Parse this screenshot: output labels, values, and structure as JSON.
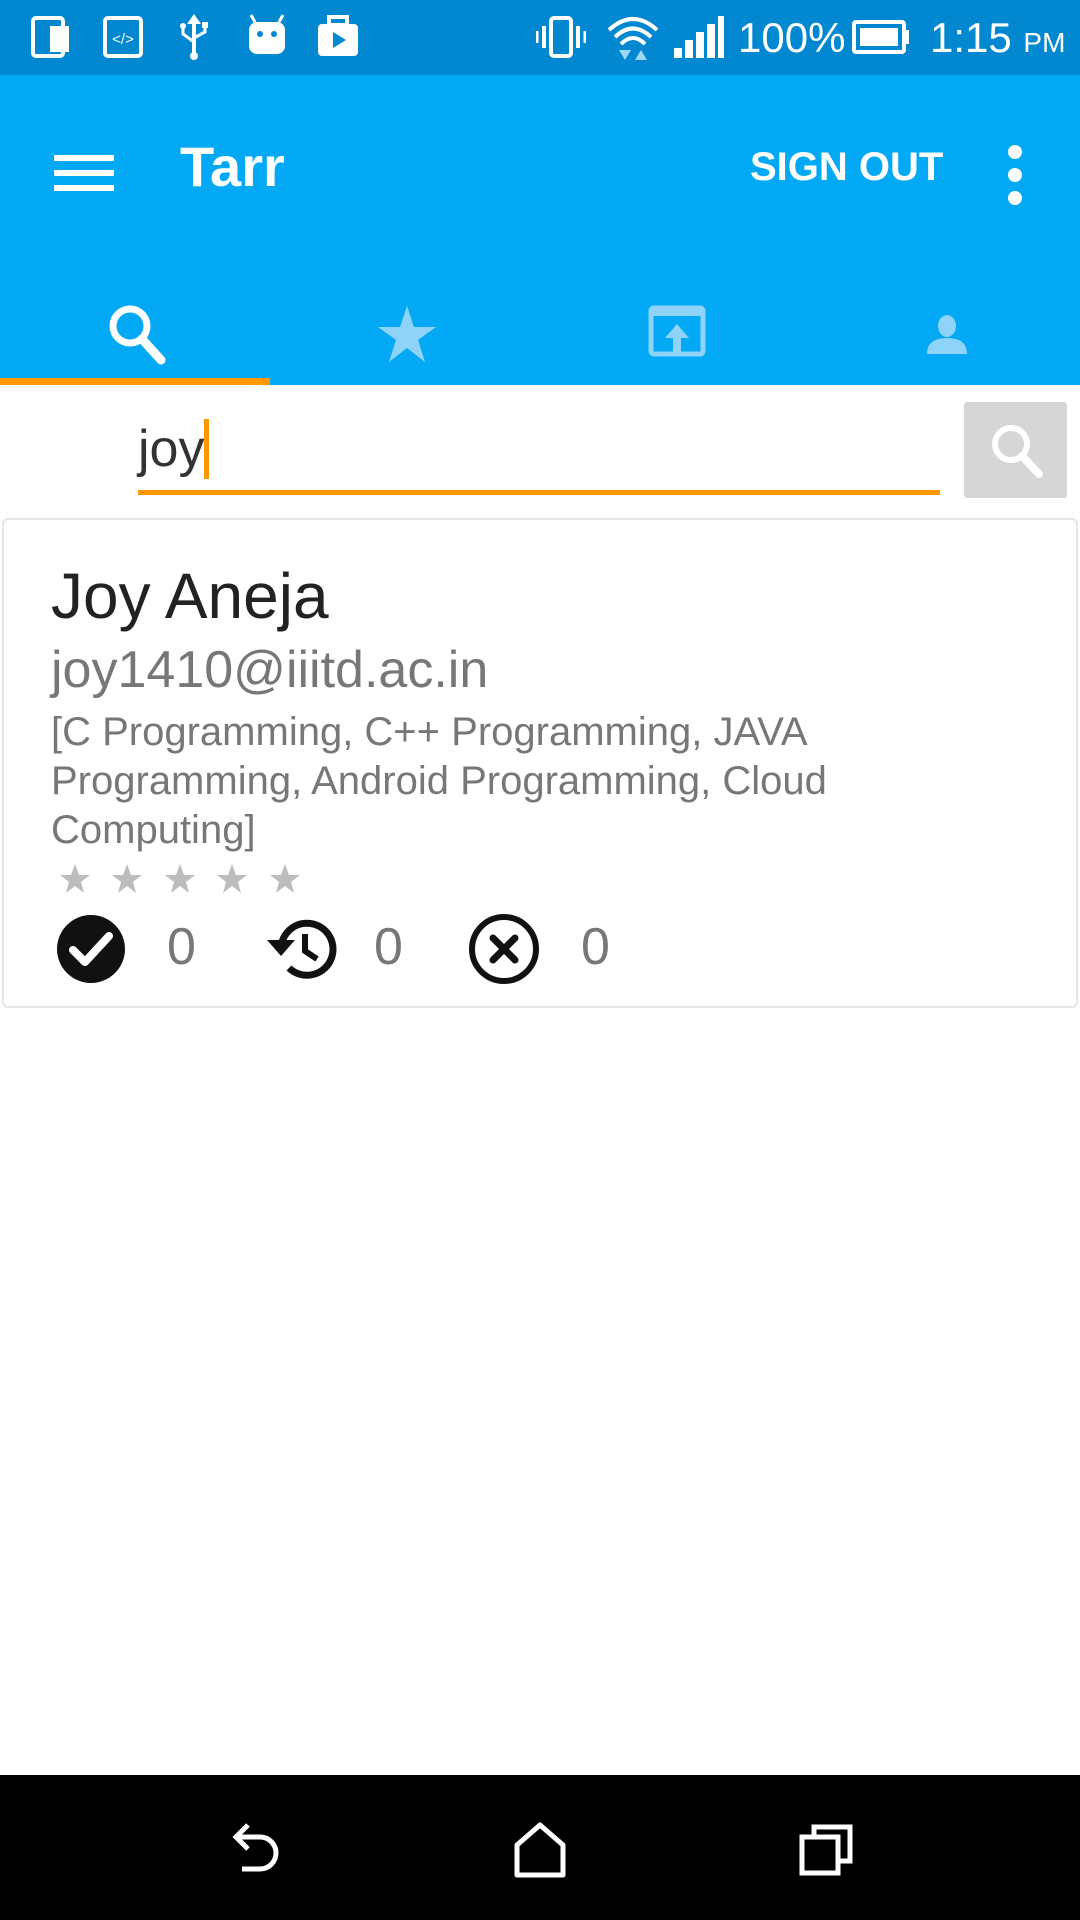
{
  "status_bar": {
    "battery": "100%",
    "time": "1:15",
    "ampm": "PM"
  },
  "app_bar": {
    "title": "Tarr",
    "sign_out": "SIGN OUT"
  },
  "tabs": [
    {
      "icon": "search-icon",
      "selected": true
    },
    {
      "icon": "star-icon",
      "selected": false
    },
    {
      "icon": "open-in-browser-icon",
      "selected": false
    },
    {
      "icon": "person-icon",
      "selected": false
    }
  ],
  "search": {
    "value": "joy"
  },
  "result": {
    "name": "Joy Aneja",
    "email": "joy1410@iiitd.ac.in",
    "skills": "[C Programming, C++ Programming, JAVA Programming, Android Programming, Cloud Computing]",
    "rating_stars": 0,
    "rating_max": 5,
    "stats": {
      "accepted": "0",
      "pending": "0",
      "rejected": "0"
    }
  },
  "colors": {
    "status_bar": "#0288d1",
    "app_bar": "#03a9f4",
    "accent": "#ff9800"
  }
}
